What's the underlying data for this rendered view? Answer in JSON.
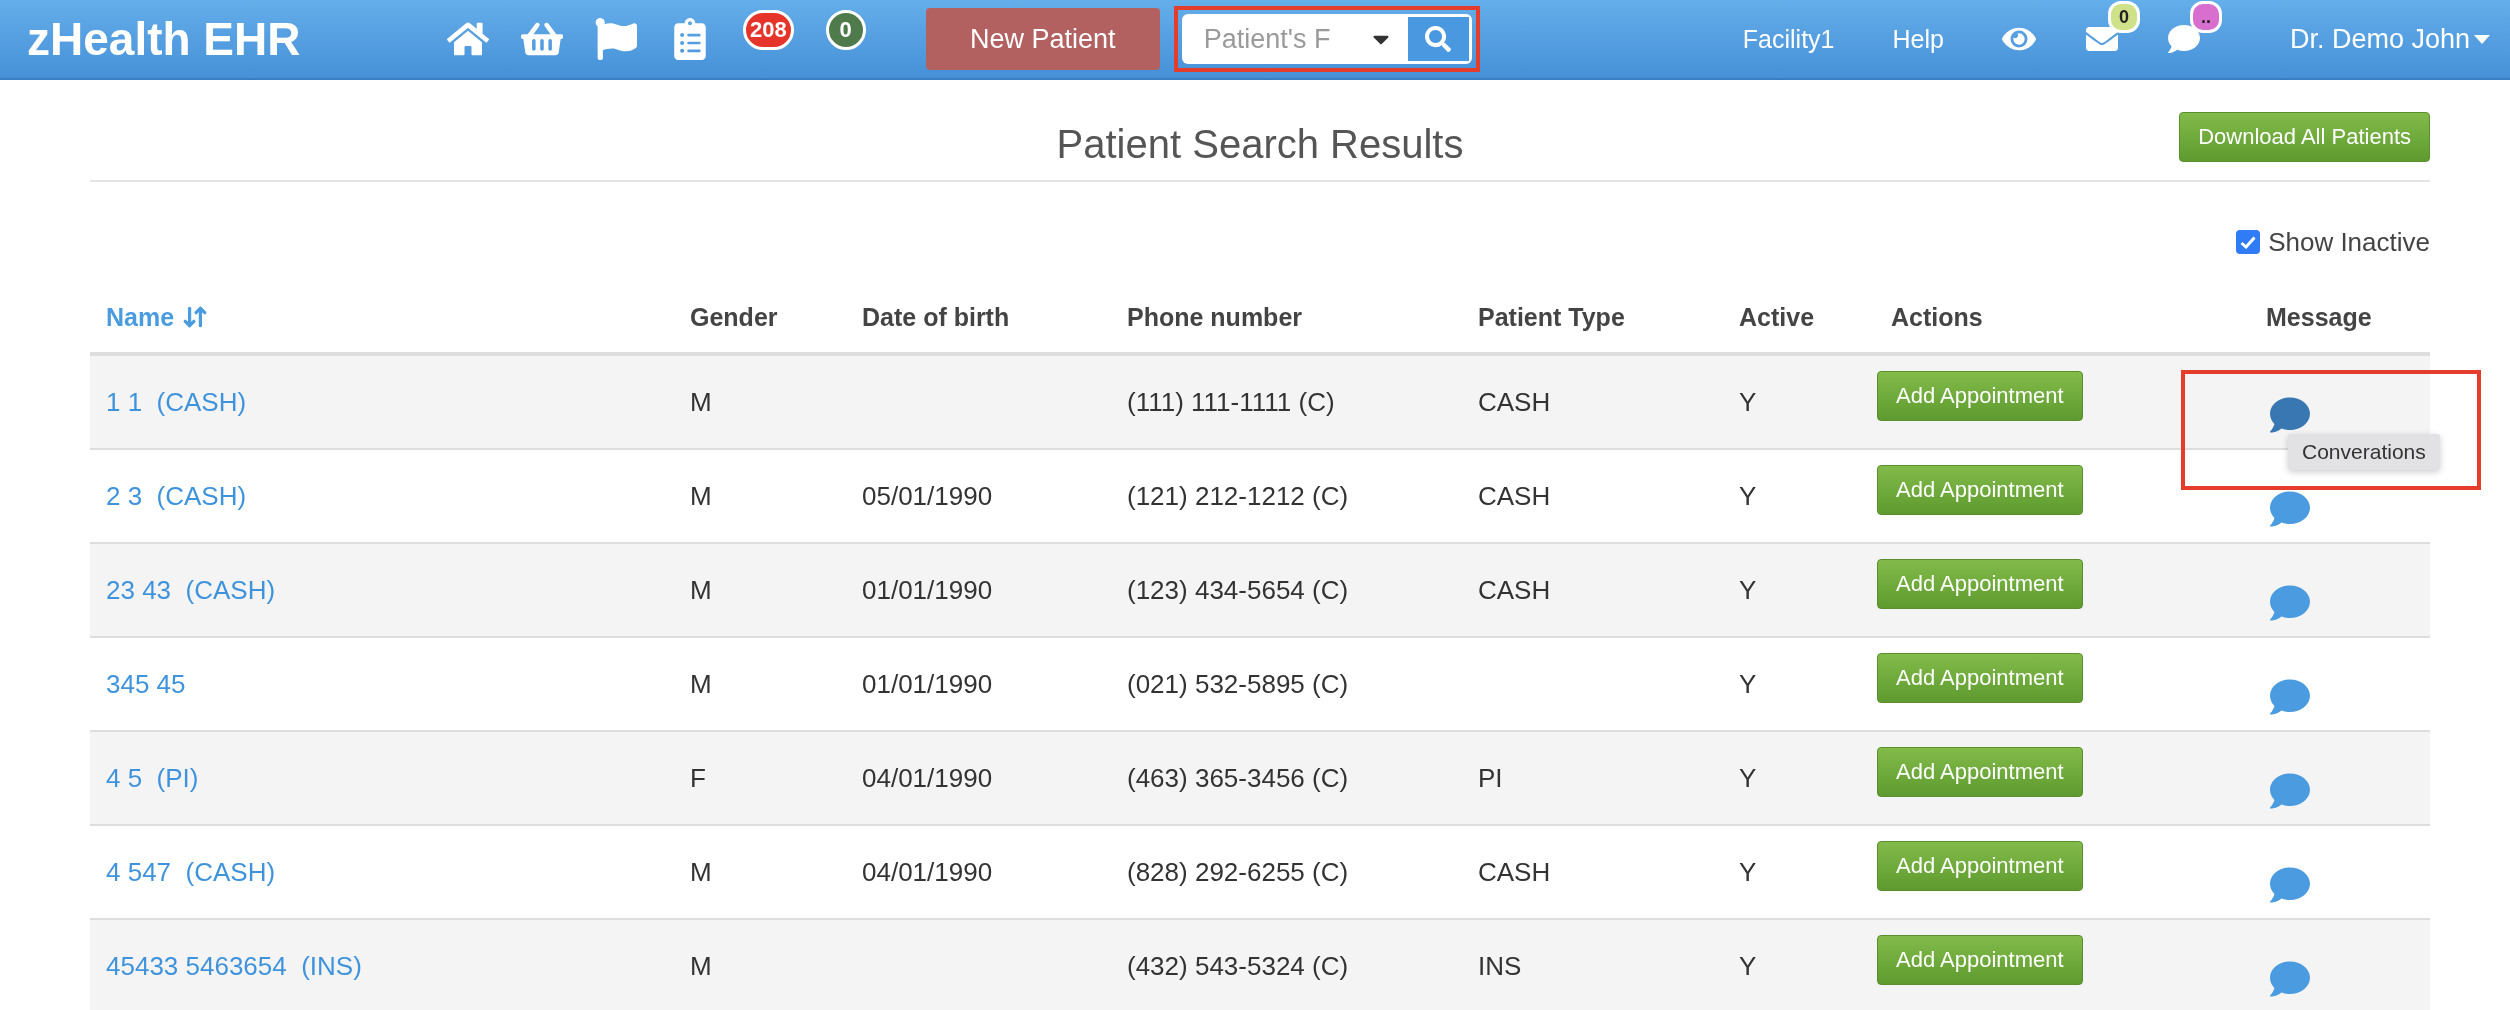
{
  "header": {
    "logo": "zHealth EHR",
    "badges": [
      {
        "text": "208",
        "color": "#e5342a"
      },
      {
        "text": "0",
        "color": "#4f7a4b"
      }
    ],
    "new_patient": "New Patient",
    "search": {
      "placeholder": "Patient's F"
    },
    "facility": "Facility1",
    "help": "Help",
    "mail_badge": "0",
    "chat_badge": "..",
    "user": "Dr. Demo John"
  },
  "title": "Patient Search Results",
  "download_button": "Download All Patients",
  "show_inactive": {
    "label": "Show Inactive",
    "checked": true
  },
  "table": {
    "columns": [
      "Name",
      "Gender",
      "Date of birth",
      "Phone number",
      "Patient Type",
      "Active",
      "Actions",
      "Message"
    ],
    "rows": [
      {
        "name": "1 1  (CASH)",
        "gender": "M",
        "dob": "",
        "phone": "(111) 111-1111 (C)",
        "type": "CASH",
        "active": "Y",
        "action": "Add Appointment",
        "hovered": true,
        "tooltip": "Converations"
      },
      {
        "name": "2 3  (CASH)",
        "gender": "M",
        "dob": "05/01/1990",
        "phone": "(121) 212-1212 (C)",
        "type": "CASH",
        "active": "Y",
        "action": "Add Appointment",
        "hovered": false
      },
      {
        "name": "23 43  (CASH)",
        "gender": "M",
        "dob": "01/01/1990",
        "phone": "(123) 434-5654 (C)",
        "type": "CASH",
        "active": "Y",
        "action": "Add Appointment",
        "hovered": false
      },
      {
        "name": "345 45",
        "gender": "M",
        "dob": "01/01/1990",
        "phone": "(021) 532-5895 (C)",
        "type": "",
        "active": "Y",
        "action": "Add Appointment",
        "hovered": false
      },
      {
        "name": "4 5  (PI)",
        "gender": "F",
        "dob": "04/01/1990",
        "phone": "(463) 365-3456 (C)",
        "type": "PI",
        "active": "Y",
        "action": "Add Appointment",
        "hovered": false
      },
      {
        "name": "4 547  (CASH)",
        "gender": "M",
        "dob": "04/01/1990",
        "phone": "(828) 292-6255 (C)",
        "type": "CASH",
        "active": "Y",
        "action": "Add Appointment",
        "hovered": false
      },
      {
        "name": "45433 5463654  (INS)",
        "gender": "M",
        "dob": "",
        "phone": "(432) 543-5324 (C)",
        "type": "INS",
        "active": "Y",
        "action": "Add Appointment",
        "hovered": false
      }
    ]
  }
}
